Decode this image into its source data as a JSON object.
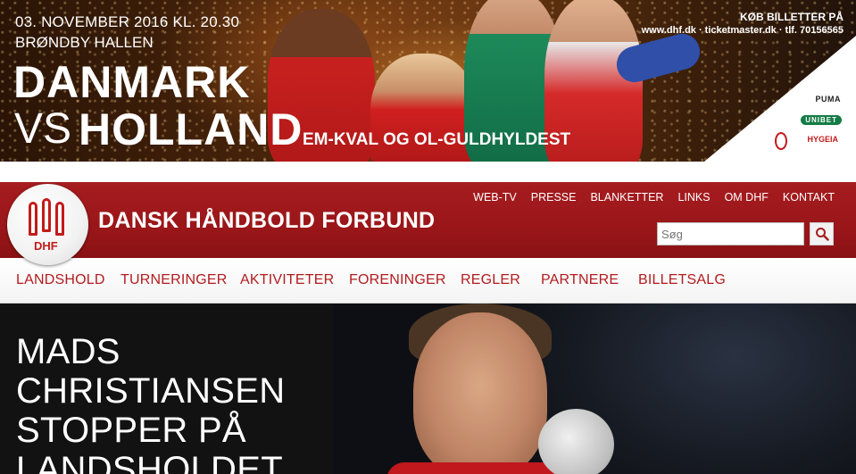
{
  "banner": {
    "date_line": "03. NOVEMBER 2016 KL. 20.30",
    "venue": "BRØNDBY HALLEN",
    "team1": "DANMARK",
    "vs": "VS",
    "team2": "HOLLAND",
    "subtitle": "EM-KVAL OG OL-GULDHYLDEST",
    "buy_tickets": "KØB BILLETTER PÅ",
    "ticket_urls": "www.dhf.dk · ticketmaster.dk · tlf. 70156565",
    "sponsors": [
      "PUMA",
      "UNIBET",
      "HYGEIA"
    ]
  },
  "header": {
    "logo_text": "DHF",
    "site_title": "DANSK HÅNDBOLD FORBUND",
    "top_links": [
      "WEB-TV",
      "PRESSE",
      "BLANKETTER",
      "LINKS",
      "OM DHF",
      "KONTAKT"
    ],
    "search": {
      "placeholder": "Søg"
    }
  },
  "nav": {
    "items": [
      "LANDSHOLD",
      "TURNERINGER",
      "AKTIVITETER",
      "FORENINGER",
      "REGLER",
      "PARTNERE",
      "BILLETSALG"
    ]
  },
  "hero": {
    "title": "MADS CHRISTIANSEN STOPPER PÅ LANDSHOLDET"
  },
  "colors": {
    "brand_red": "#a61c1f",
    "nav_text": "#b31b1e"
  },
  "icons": {
    "search_button": "search-icon"
  }
}
